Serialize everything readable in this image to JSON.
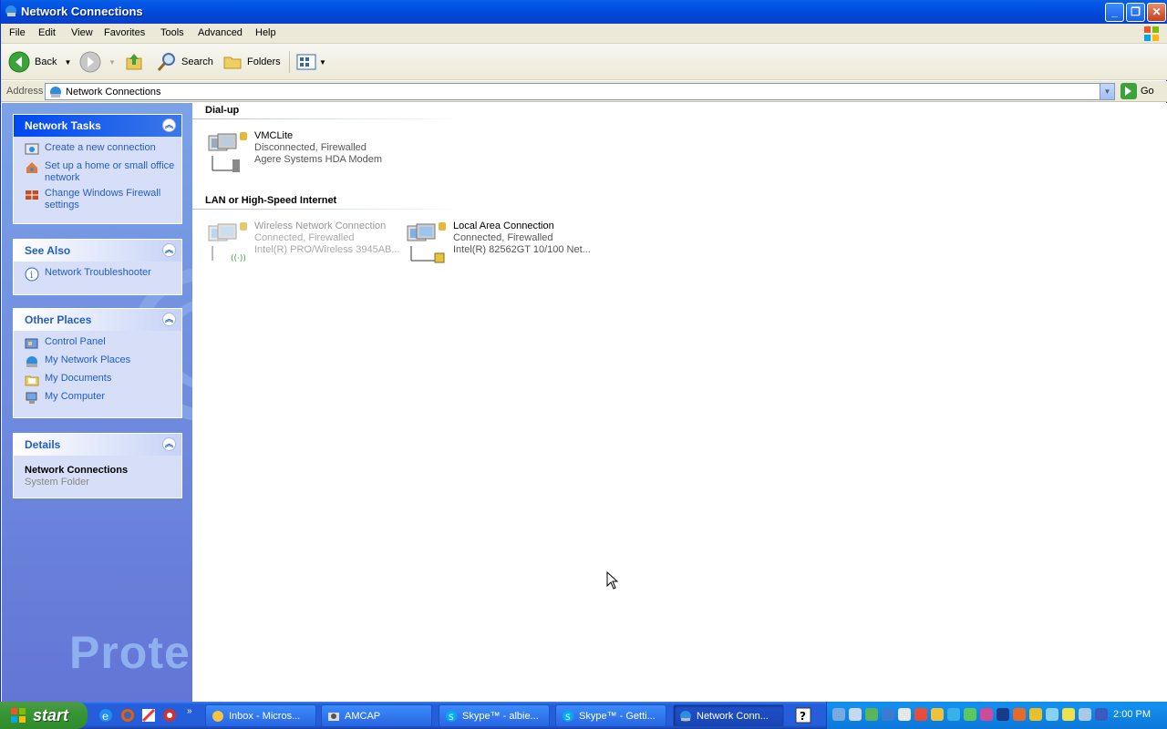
{
  "window": {
    "title": "Network Connections"
  },
  "menu": [
    "File",
    "Edit",
    "View",
    "Favorites",
    "Tools",
    "Advanced",
    "Help"
  ],
  "toolbar": {
    "back": "Back",
    "search": "Search",
    "folders": "Folders"
  },
  "address": {
    "label": "Address",
    "value": "Network Connections",
    "go": "Go"
  },
  "tasks": {
    "network_tasks": {
      "title": "Network Tasks",
      "items": [
        "Create a new connection",
        "Set up a home or small office network",
        "Change Windows Firewall settings"
      ]
    },
    "see_also": {
      "title": "See Also",
      "items": [
        "Network Troubleshooter"
      ]
    },
    "other_places": {
      "title": "Other Places",
      "items": [
        "Control Panel",
        "My Network Places",
        "My Documents",
        "My Computer"
      ]
    },
    "details": {
      "title": "Details",
      "name": "Network Connections",
      "type": "System Folder"
    }
  },
  "watermark": "Prote",
  "groups": {
    "dialup": {
      "title": "Dial-up",
      "items": [
        {
          "name": "VMCLite",
          "status": "Disconnected, Firewalled",
          "device": "Agere Systems HDA Modem"
        }
      ]
    },
    "lan": {
      "title": "LAN or High-Speed Internet",
      "items": [
        {
          "name": "Wireless Network Connection",
          "status": "Connected, Firewalled",
          "device": "Intel(R) PRO/Wireless 3945AB..."
        },
        {
          "name": "Local Area Connection",
          "status": "Connected, Firewalled",
          "device": "Intel(R) 82562GT 10/100 Net..."
        }
      ]
    }
  },
  "taskbar": {
    "start": "start",
    "tasks": [
      "Inbox - Micros...",
      "AMCAP",
      "Skype™ - albie...",
      "Skype™ - Getti...",
      "Network Conn..."
    ],
    "clock": "2:00 PM"
  }
}
